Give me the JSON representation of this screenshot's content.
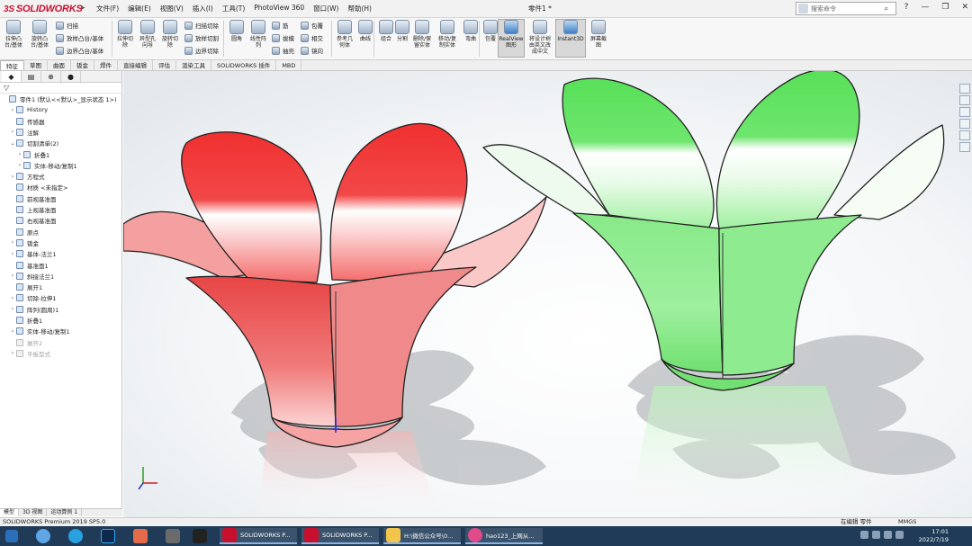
{
  "app": {
    "logo": "SOLIDWORKS",
    "doc_title": "零件1 *"
  },
  "menus": [
    "文件(F)",
    "编辑(E)",
    "视图(V)",
    "插入(I)",
    "工具(T)",
    "PhotoView 360",
    "窗口(W)",
    "帮助(H)"
  ],
  "search": {
    "placeholder": "搜索命令"
  },
  "toolbar": {
    "extrude_boss": "拉伸凸\n台/基体",
    "revolve_boss": "旋转凸\n台/基体",
    "sweep": "扫描",
    "loft": "放样凸台/基体",
    "boundary_boss": "边界凸台/基体",
    "extrude_cut": "拉伸切\n除",
    "hole_wizard": "异型孔\n向导",
    "revolve_cut": "旋转切\n除",
    "swept_cut": "扫描切除",
    "lofted_cut": "放样切割",
    "boundary_cut": "边界切除",
    "fillet": "圆角",
    "linear_pattern": "线性阵\n列",
    "rib": "筋",
    "draft": "拔模",
    "shell": "抽壳",
    "wrap": "包覆",
    "intersect": "相交",
    "mirror": "镜向",
    "ref_geometry": "参考几\n何体",
    "curves": "曲线",
    "combine": "组合",
    "split": "分割",
    "delete_keep": "删除/保\n留实体",
    "move_copy": "移动/复\n制实体",
    "indent": "弯曲",
    "wrap2": "包覆",
    "realview": "RealView\n图形",
    "custom": "将设计树\n由英文改\n成中文",
    "instant3d": "Instant3D",
    "screen_capture": "屏幕截\n图"
  },
  "tabs": [
    "特征",
    "草图",
    "曲面",
    "钣金",
    "焊件",
    "直接编辑",
    "评估",
    "渲染工具",
    "SOLIDWORKS 插件",
    "MBD"
  ],
  "feature_tree": [
    {
      "label": "零件1 (默认<<默认>_显示状态 1>)",
      "indent": 0,
      "arrow": ""
    },
    {
      "label": "History",
      "indent": 1,
      "arrow": "›"
    },
    {
      "label": "传感器",
      "indent": 1,
      "arrow": ""
    },
    {
      "label": "注解",
      "indent": 1,
      "arrow": "›"
    },
    {
      "label": "切割清单(2)",
      "indent": 1,
      "arrow": "⌄"
    },
    {
      "label": "折叠1",
      "indent": 2,
      "arrow": "›"
    },
    {
      "label": "实体-移动/复制1",
      "indent": 2,
      "arrow": "›"
    },
    {
      "label": "方程式",
      "indent": 1,
      "arrow": "›"
    },
    {
      "label": "材质 <未指定>",
      "indent": 1,
      "arrow": ""
    },
    {
      "label": "前视基准面",
      "indent": 1,
      "arrow": ""
    },
    {
      "label": "上视基准面",
      "indent": 1,
      "arrow": ""
    },
    {
      "label": "右视基准面",
      "indent": 1,
      "arrow": ""
    },
    {
      "label": "原点",
      "indent": 1,
      "arrow": ""
    },
    {
      "label": "钣金",
      "indent": 1,
      "arrow": "›"
    },
    {
      "label": "基体-法兰1",
      "indent": 1,
      "arrow": "›"
    },
    {
      "label": "基准面1",
      "indent": 1,
      "arrow": ""
    },
    {
      "label": "斜接法兰1",
      "indent": 1,
      "arrow": "›"
    },
    {
      "label": "展开1",
      "indent": 1,
      "arrow": ""
    },
    {
      "label": "切除-拉伸1",
      "indent": 1,
      "arrow": "›"
    },
    {
      "label": "阵列(圆周)1",
      "indent": 1,
      "arrow": "›"
    },
    {
      "label": "折叠1",
      "indent": 1,
      "arrow": ""
    },
    {
      "label": "实体-移动/复制1",
      "indent": 1,
      "arrow": "›"
    },
    {
      "label": "展开2",
      "indent": 1,
      "arrow": "",
      "dim": true
    },
    {
      "label": "平板型式",
      "indent": 1,
      "arrow": "›",
      "dim": true
    }
  ],
  "fm_bottom_tabs": [
    "模型",
    "3D 视图",
    "运动算例 1"
  ],
  "status": {
    "version": "SOLIDWORKS Premium 2019 SP5.0",
    "mode": "在编辑 零件",
    "units": "MMGS"
  },
  "taskbar": {
    "apps": [
      "SOLIDWORKS P...",
      "SOLIDWORKS P...",
      "H:\\微信公众号\\0...",
      "hao123_上网从..."
    ],
    "time": "17:01",
    "date": "2022/7/19"
  },
  "colors": {
    "red_model": "#f03c3c",
    "green_model": "#5fe65f",
    "brand": "#c8102e"
  }
}
